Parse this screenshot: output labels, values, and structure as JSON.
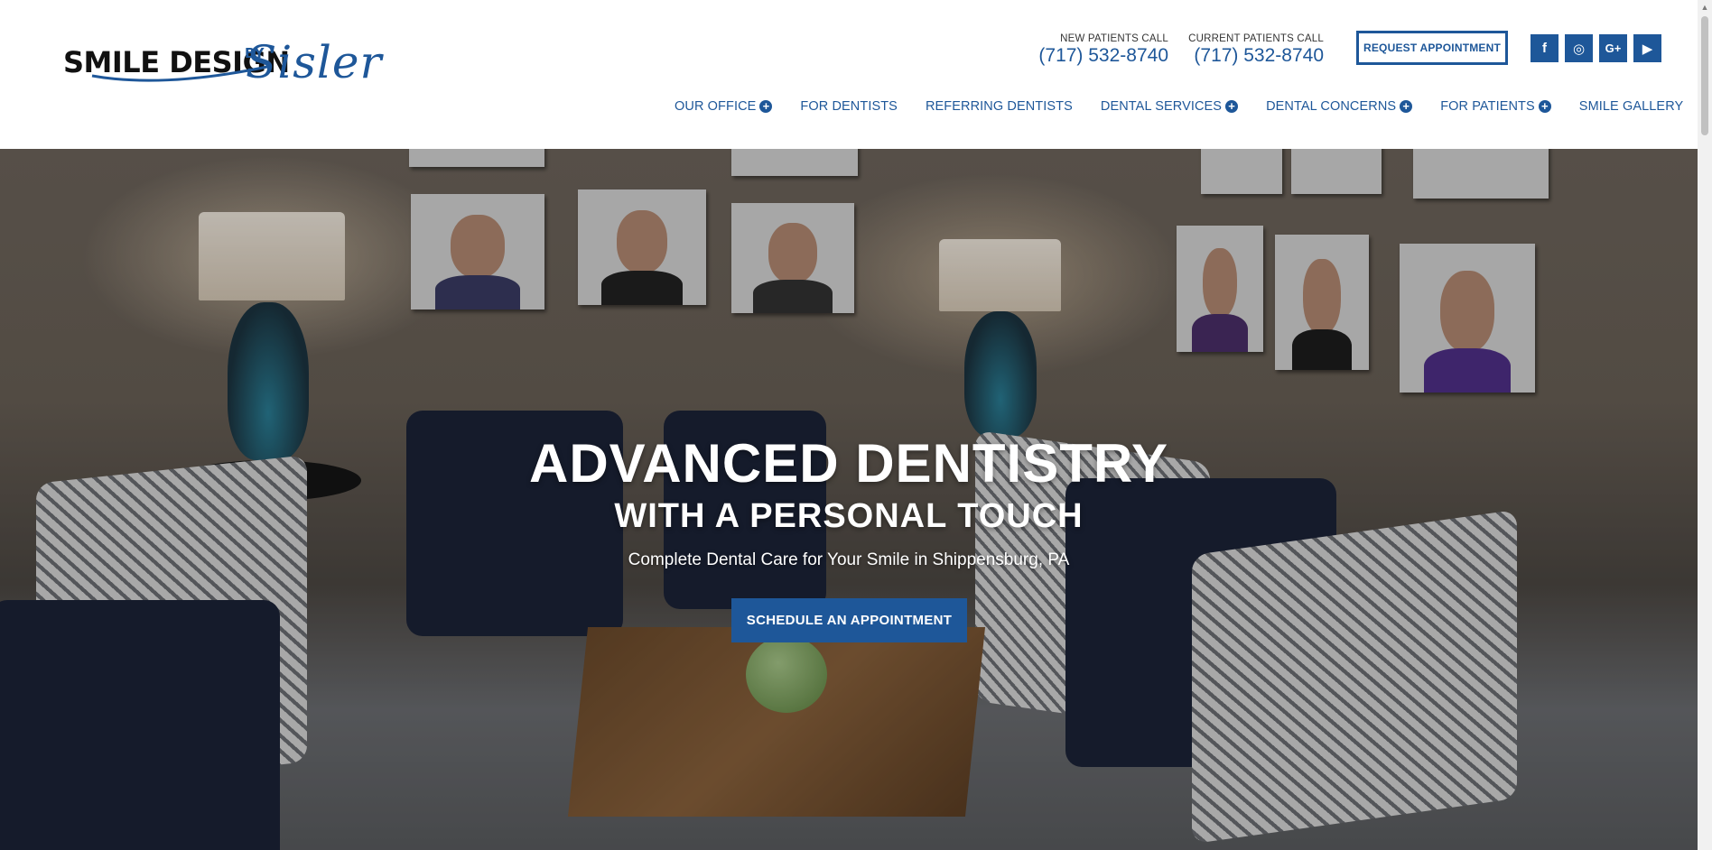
{
  "brand": {
    "logo_main": "SMILE DESIGN",
    "logo_by": "BY",
    "logo_script": "Sisler"
  },
  "contact": {
    "new_patients_label": "NEW PATIENTS CALL",
    "new_patients_phone": "(717) 532-8740",
    "current_patients_label": "CURRENT PATIENTS CALL",
    "current_patients_phone": "(717) 532-8740",
    "request_button": "REQUEST APPOINTMENT"
  },
  "social": {
    "facebook": "f",
    "instagram": "◎",
    "google_plus": "G+",
    "youtube": "▶"
  },
  "nav": {
    "items": [
      {
        "label": "OUR OFFICE",
        "has_submenu": true
      },
      {
        "label": "FOR DENTISTS",
        "has_submenu": false
      },
      {
        "label": "REFERRING DENTISTS",
        "has_submenu": false
      },
      {
        "label": "DENTAL SERVICES",
        "has_submenu": true
      },
      {
        "label": "DENTAL CONCERNS",
        "has_submenu": true
      },
      {
        "label": "FOR PATIENTS",
        "has_submenu": true
      },
      {
        "label": "SMILE GALLERY",
        "has_submenu": false
      }
    ],
    "submenu_symbol": "+"
  },
  "hero": {
    "title": "ADVANCED DENTISTRY",
    "subtitle": "WITH A PERSONAL TOUCH",
    "tagline": "Complete Dental Care for Your Smile in Shippensburg, PA",
    "cta": "SCHEDULE AN APPOINTMENT"
  },
  "colors": {
    "brand_blue": "#1e5799",
    "text_dark": "#111111",
    "white": "#ffffff"
  }
}
